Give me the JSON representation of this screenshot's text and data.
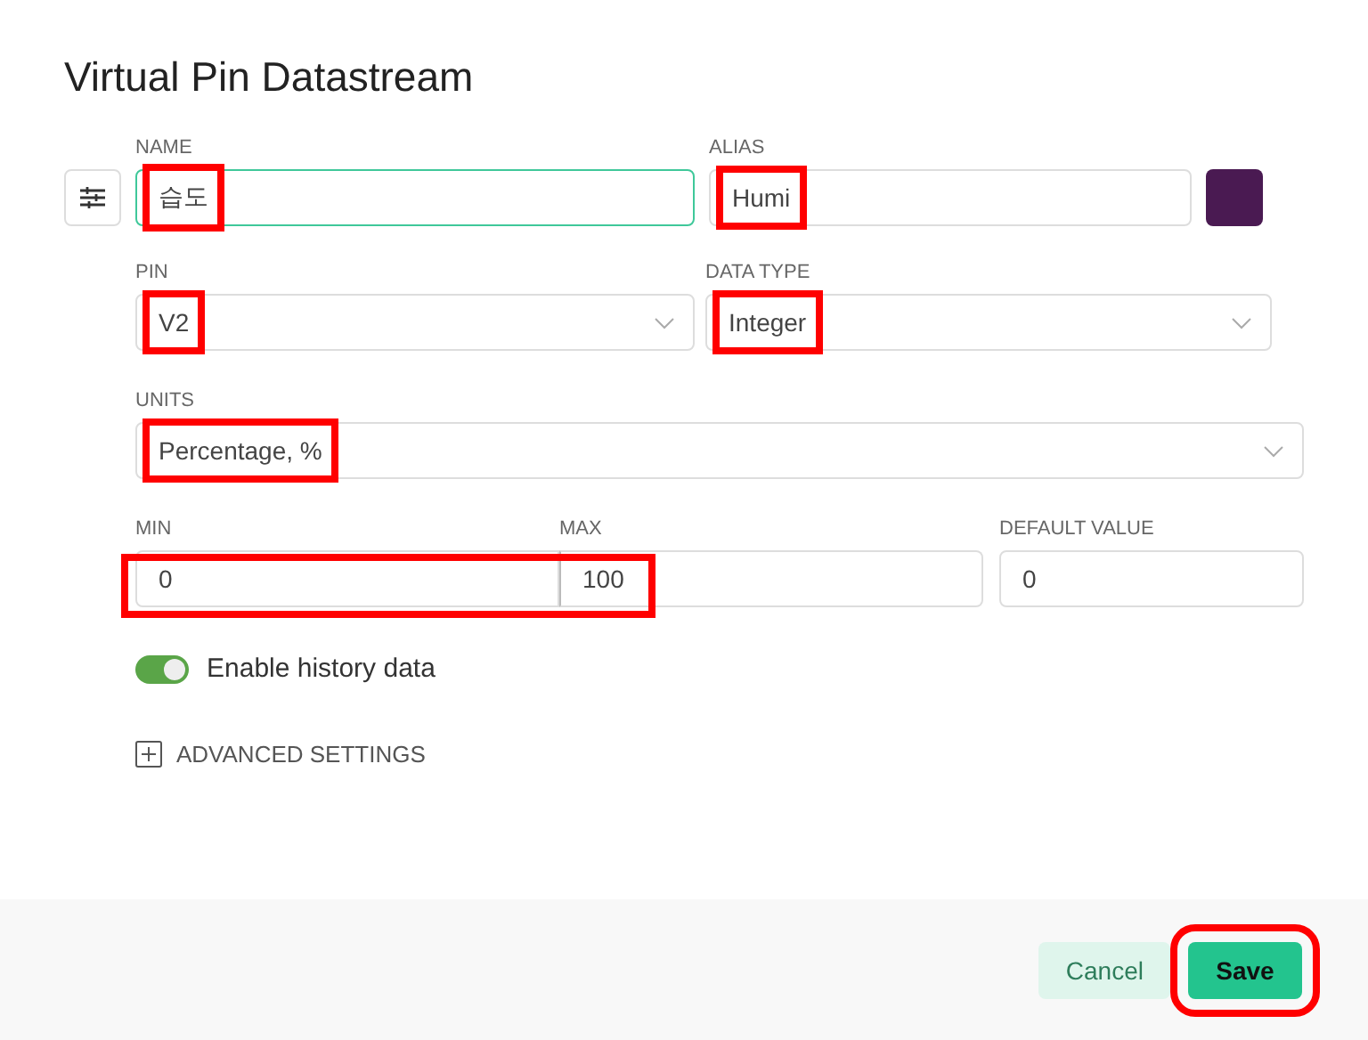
{
  "title": "Virtual Pin Datastream",
  "name": {
    "label": "NAME",
    "value": "습도",
    "focused": true,
    "highlight": true
  },
  "alias": {
    "label": "ALIAS",
    "value": "Humi",
    "highlight": true
  },
  "color": "#4a1a52",
  "pin": {
    "label": "PIN",
    "value": "V2",
    "highlight": true
  },
  "data_type": {
    "label": "DATA TYPE",
    "value": "Integer",
    "highlight": true
  },
  "units": {
    "label": "UNITS",
    "value": "Percentage, %",
    "highlight": true
  },
  "min": {
    "label": "MIN",
    "value": "0"
  },
  "max": {
    "label": "MAX",
    "value": "100"
  },
  "min_max_highlight": true,
  "default_value": {
    "label": "DEFAULT VALUE",
    "value": "0"
  },
  "history": {
    "label": "Enable history data",
    "on": true
  },
  "advanced": {
    "label": "ADVANCED SETTINGS",
    "expanded": false
  },
  "buttons": [
    {
      "kind": "cancel",
      "label": "Cancel",
      "highlight": false
    },
    {
      "kind": "save",
      "label": "Save",
      "highlight": true
    }
  ]
}
